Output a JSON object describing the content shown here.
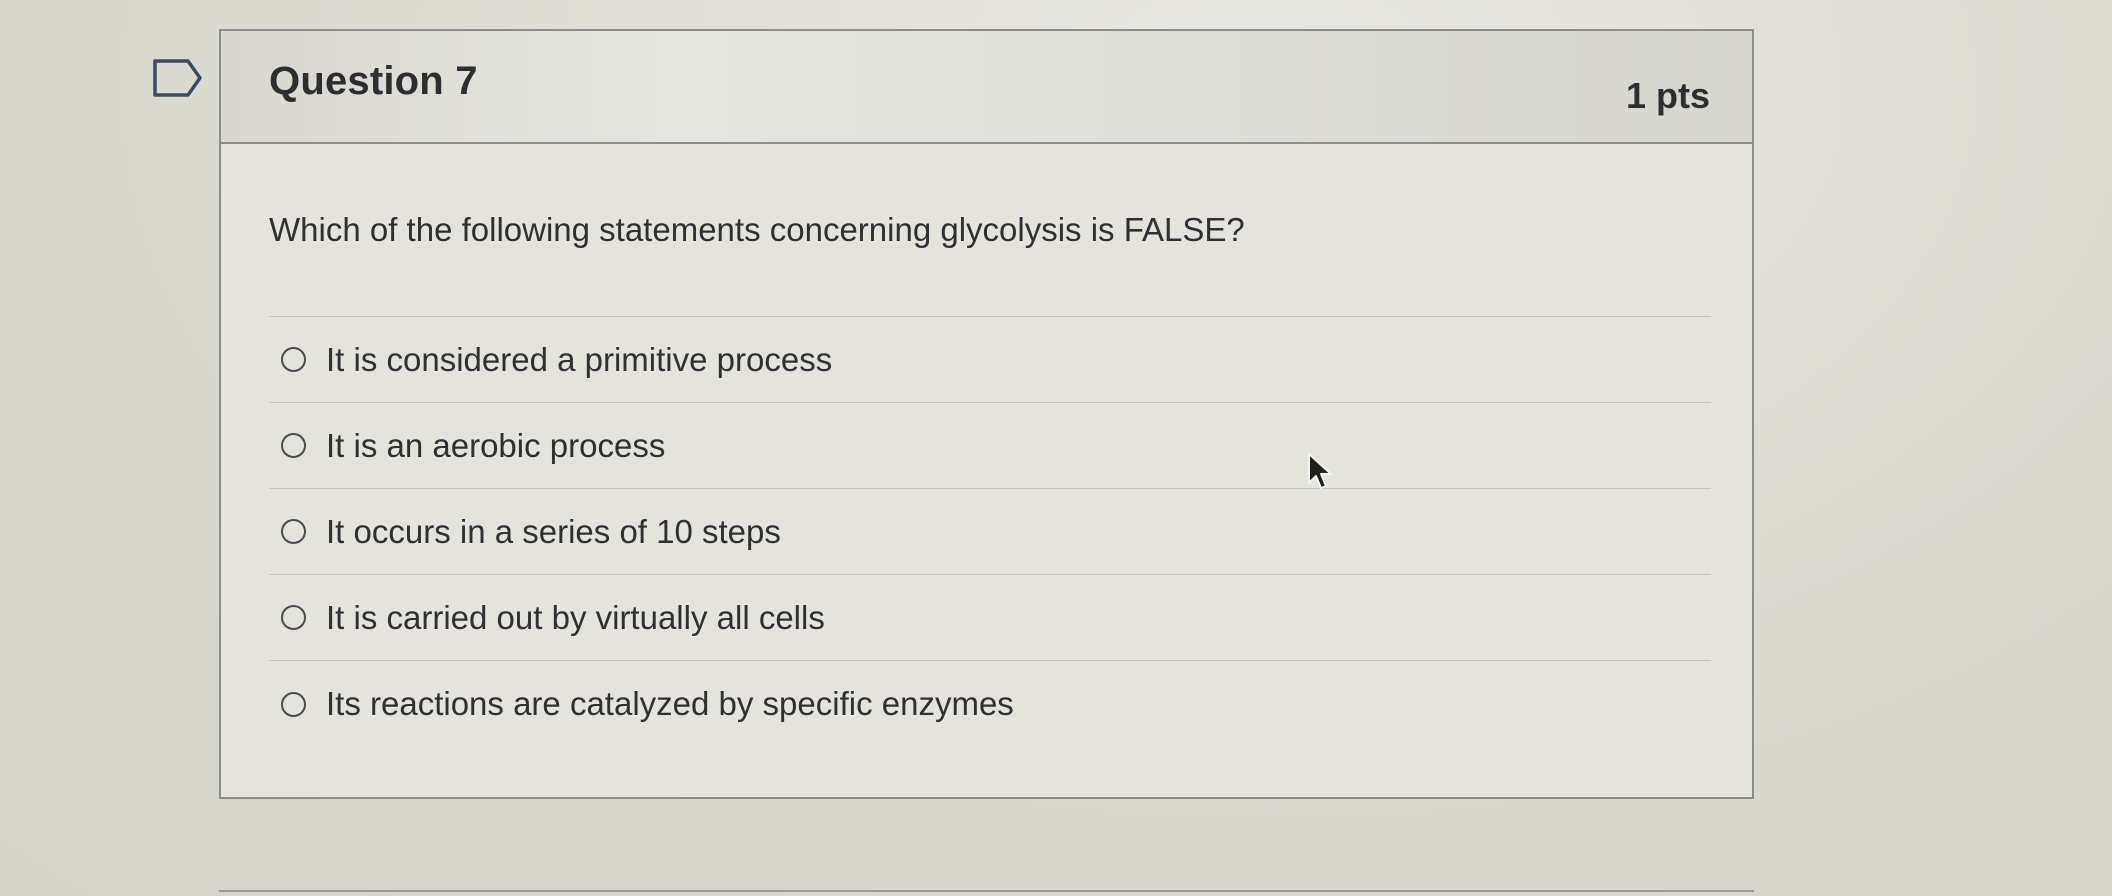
{
  "question": {
    "title": "Question 7",
    "points": "1 pts",
    "prompt": "Which of the following statements concerning glycolysis is FALSE?",
    "answers": [
      {
        "label": "It is considered a primitive process",
        "selected": false
      },
      {
        "label": "It is an aerobic process",
        "selected": false
      },
      {
        "label": "It occurs in a series of 10 steps",
        "selected": false
      },
      {
        "label": "It is carried out by virtually all cells",
        "selected": false
      },
      {
        "label": "Its reactions are catalyzed by specific enzymes",
        "selected": false
      }
    ]
  },
  "icons": {
    "flag": "flag-outline-icon",
    "cursor": "mouse-pointer-icon"
  },
  "colors": {
    "text": "#2f3033",
    "border": "#8c8d8a",
    "divider": "#c4c5bf"
  }
}
